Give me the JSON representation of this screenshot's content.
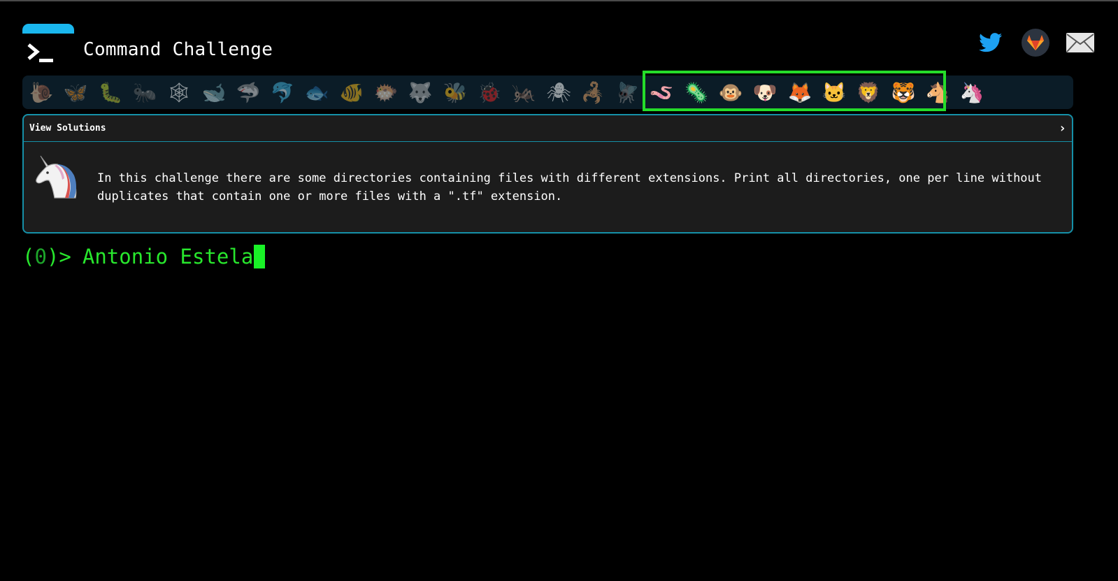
{
  "header": {
    "title": "Command Challenge",
    "logo_icon": "terminal-prompt-icon",
    "accent_color": "#1ab7ee",
    "social": [
      {
        "name": "twitter-icon",
        "color": "#1da1f2"
      },
      {
        "name": "gitlab-icon",
        "color": "#fc6d26"
      },
      {
        "name": "mail-icon",
        "color": "#e6e6e6"
      }
    ]
  },
  "animals": [
    {
      "icon": "snail-icon",
      "glyph": "🐌"
    },
    {
      "icon": "butterfly-icon",
      "glyph": "🦋"
    },
    {
      "icon": "caterpillar-icon",
      "glyph": "🐛"
    },
    {
      "icon": "ant-icon",
      "glyph": "🐜"
    },
    {
      "icon": "spiderweb-icon",
      "glyph": "🕸"
    },
    {
      "icon": "whale-icon",
      "glyph": "🐋"
    },
    {
      "icon": "shark-icon",
      "glyph": "🦈"
    },
    {
      "icon": "dolphin-icon",
      "glyph": "🐬"
    },
    {
      "icon": "fish-icon",
      "glyph": "🐟"
    },
    {
      "icon": "tropical-fish-icon",
      "glyph": "🐠"
    },
    {
      "icon": "blowfish-icon",
      "glyph": "🐡"
    },
    {
      "icon": "wolf-icon",
      "glyph": "🐺"
    },
    {
      "icon": "bee-icon",
      "glyph": "🐝"
    },
    {
      "icon": "ladybug-icon",
      "glyph": "🐞"
    },
    {
      "icon": "cricket-icon",
      "glyph": "🦗"
    },
    {
      "icon": "spider-icon",
      "glyph": "🕷"
    },
    {
      "icon": "scorpion-icon",
      "glyph": "🦂"
    },
    {
      "icon": "fly-icon",
      "glyph": "🪰"
    },
    {
      "icon": "worm-icon",
      "glyph": "🪱"
    },
    {
      "icon": "microbe-icon",
      "glyph": "🦠"
    },
    {
      "icon": "monkey-icon",
      "glyph": "🐵"
    },
    {
      "icon": "dog-icon",
      "glyph": "🐶"
    },
    {
      "icon": "fox-icon",
      "glyph": "🦊"
    },
    {
      "icon": "cat-icon",
      "glyph": "🐱"
    },
    {
      "icon": "lion-icon",
      "glyph": "🦁"
    },
    {
      "icon": "tiger-icon",
      "glyph": "🐯"
    },
    {
      "icon": "horse-icon",
      "glyph": "🐴"
    },
    {
      "icon": "unicorn-icon",
      "glyph": "🦄"
    }
  ],
  "solutions_panel": {
    "title": "View Solutions",
    "chevron_icon": "chevron-right-icon",
    "border_color": "#1590a8",
    "challenge_icon": "unicorn-icon",
    "description": "In this challenge there are some directories containing files with different extensions. Print all directories, one per line without duplicates that contain one or more files with a \".tf\" extension."
  },
  "terminal": {
    "prompt_open": "(",
    "prompt_count": "0",
    "prompt_close": ")>",
    "input_value": "Antonio Estela",
    "prompt_color": "#28e72d"
  },
  "highlight_color": "#25dd2a"
}
